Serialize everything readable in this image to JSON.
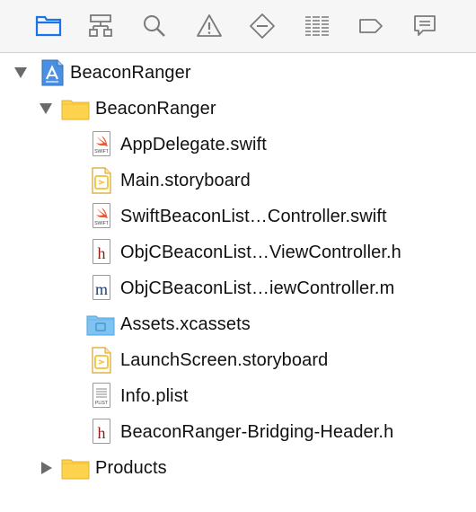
{
  "toolbar": {
    "icons": [
      {
        "name": "project-navigator-icon",
        "selected": true
      },
      {
        "name": "symbol-navigator-icon",
        "selected": false
      },
      {
        "name": "find-navigator-icon",
        "selected": false
      },
      {
        "name": "issue-navigator-icon",
        "selected": false
      },
      {
        "name": "test-navigator-icon",
        "selected": false
      },
      {
        "name": "debug-navigator-icon",
        "selected": false
      },
      {
        "name": "breakpoint-navigator-icon",
        "selected": false
      },
      {
        "name": "report-navigator-icon",
        "selected": false
      }
    ],
    "accent_color": "#1a73e8"
  },
  "tree": {
    "project": {
      "label": "BeaconRanger",
      "icon": "xcode-project-icon",
      "expanded": true
    },
    "group": {
      "label": "BeaconRanger",
      "icon": "folder-icon",
      "expanded": true
    },
    "files": [
      {
        "label": "AppDelegate.swift",
        "icon": "swift-file-icon",
        "badge": "SWIFT"
      },
      {
        "label": "Main.storyboard",
        "icon": "storyboard-file-icon"
      },
      {
        "label": "SwiftBeaconList…Controller.swift",
        "icon": "swift-file-icon",
        "badge": "SWIFT"
      },
      {
        "label": "ObjCBeaconList…ViewController.h",
        "icon": "header-file-icon",
        "letter": "h"
      },
      {
        "label": "ObjCBeaconList…iewController.m",
        "icon": "objc-file-icon",
        "letter": "m"
      },
      {
        "label": "Assets.xcassets",
        "icon": "asset-catalog-icon"
      },
      {
        "label": "LaunchScreen.storyboard",
        "icon": "storyboard-file-icon"
      },
      {
        "label": "Info.plist",
        "icon": "plist-file-icon",
        "badge": "PLIST"
      },
      {
        "label": "BeaconRanger-Bridging-Header.h",
        "icon": "header-file-icon",
        "letter": "h"
      }
    ],
    "products": {
      "label": "Products",
      "icon": "folder-icon",
      "expanded": false
    }
  },
  "colors": {
    "folder_yellow": "#fdd24c",
    "folder_blue": "#7fc3f0",
    "header_red": "#8b1a1a",
    "objc_blue": "#1c3d7a",
    "swift_orange": "#f0582c",
    "storyboard_yellow": "#f3c846"
  }
}
